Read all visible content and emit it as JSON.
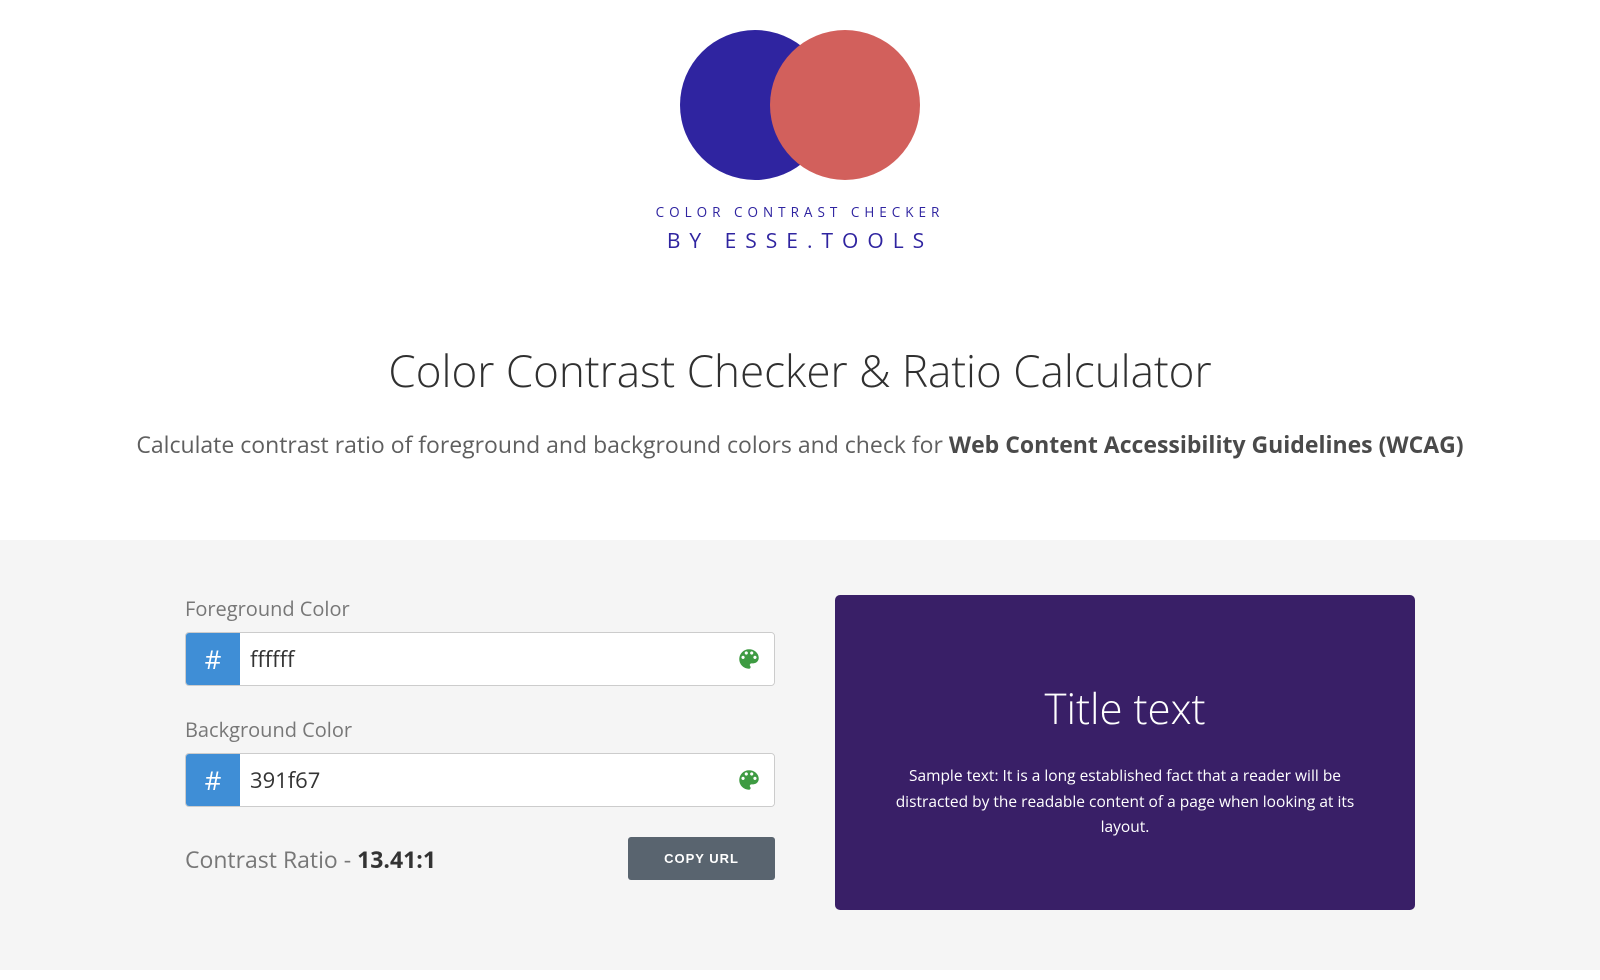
{
  "logo": {
    "sub": "COLOR CONTRAST CHECKER",
    "main": "BY ESSE.TOOLS",
    "colors": {
      "left": "#2f24a0",
      "right": "#d2605c"
    }
  },
  "title": "Color Contrast Checker & Ratio Calculator",
  "subtitle_prefix": "Calculate contrast ratio of foreground and background colors and check for ",
  "subtitle_bold": "Web Content Accessibility Guidelines (WCAG)",
  "fields": {
    "fg_label": "Foreground Color",
    "bg_label": "Background Color",
    "hash": "#",
    "fg_value": "ffffff",
    "bg_value": "391f67"
  },
  "ratio": {
    "label": "Contrast Ratio - ",
    "value": "13.41:1"
  },
  "buttons": {
    "copy_url": "COPY URL"
  },
  "preview": {
    "title": "Title text",
    "body": "Sample text: It is a long established fact that a reader will be distracted by the readable content of a page when looking at its layout.",
    "fg": "#ffffff",
    "bg": "#391f67"
  }
}
